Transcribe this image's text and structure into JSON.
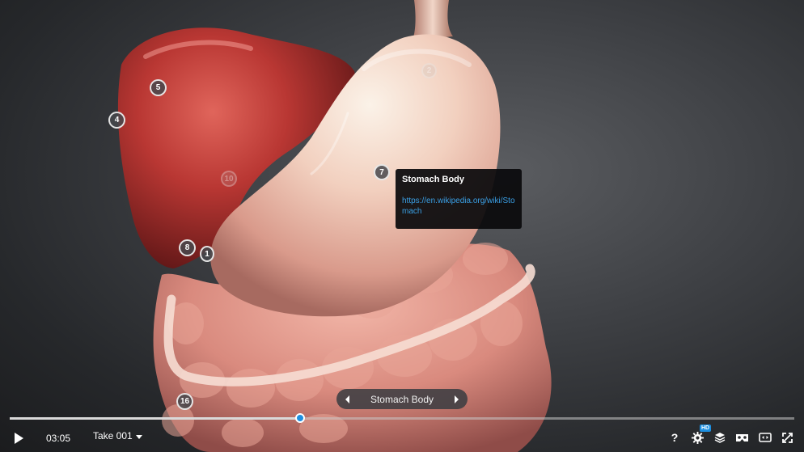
{
  "hotspots": [
    {
      "label": "5"
    },
    {
      "label": "4"
    },
    {
      "label": "2"
    },
    {
      "label": "7"
    },
    {
      "label": "10"
    },
    {
      "label": "8"
    },
    {
      "label": "1"
    },
    {
      "label": "16"
    }
  ],
  "tooltip": {
    "title": "Stomach Body",
    "link": "https://en.wikipedia.org/wiki/Stomach"
  },
  "part_nav": {
    "label": "Stomach Body",
    "prev_icon": "caret-left-icon",
    "next_icon": "caret-right-icon"
  },
  "timeline": {
    "progress_fraction": 0.37
  },
  "controls": {
    "current_time": "03:05",
    "take_label": "Take 001",
    "help_label": "?",
    "hd_badge": "HD",
    "icons": [
      "play-icon",
      "caret-down-icon",
      "help-icon",
      "settings-icon",
      "layers-icon",
      "vr-headset-icon",
      "theater-mode-icon",
      "fullscreen-icon"
    ]
  },
  "colors": {
    "accent": "#1d8fe0",
    "link": "#3aa0e6",
    "background": "#3e4044"
  }
}
